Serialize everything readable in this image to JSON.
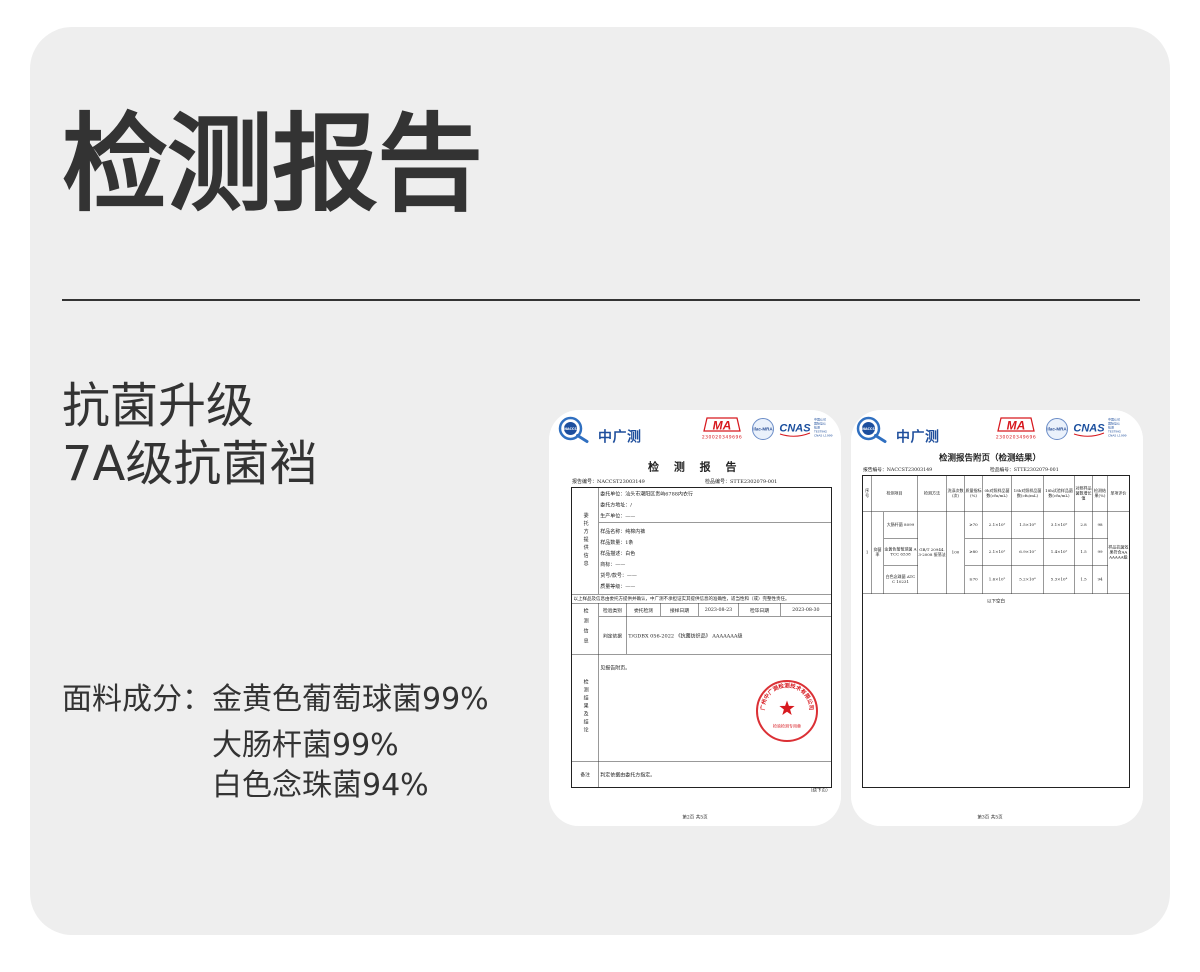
{
  "colors": {
    "page_bg": "#ffffff",
    "card_bg": "#eeeeee",
    "text": "#333333",
    "brand_blue": "#1e4e9c",
    "mark_red": "#d7191f"
  },
  "heading": {
    "title": "检测报告"
  },
  "headline": {
    "line1": "抗菌升级",
    "line2": "7A级抗菌裆"
  },
  "composition": {
    "label": "面料成分：",
    "items": [
      "金黄色葡萄球菌99%",
      "大肠杆菌99%",
      "白色念珠菌94%"
    ]
  },
  "report_main": {
    "header": {
      "logo_text": "NACCS",
      "brand": "中广测",
      "ma": "MA",
      "ma_number": "230020349696",
      "ilac": "ilac-MRA",
      "cnas": "CNAS",
      "cnas_caption": [
        "中国认可",
        "国际互认",
        "检测",
        "TESTING",
        "CNAS L1999"
      ]
    },
    "title": "检 测 报 告",
    "report_no": "报告编号：NACCST23003149",
    "sample_no": "检品编号：STTE2302079-001",
    "client": {
      "label": "委托方提供信息",
      "group1": [
        "委托单位：汕头市潮阳区贵屿6788内衣行",
        "委托方地址：/",
        "生产单位：——"
      ],
      "group2": [
        "样品名称：纯棉内裤",
        "样品数量：1条",
        "样品描述：白色",
        "商标：——",
        "货号/款号：——",
        "质量等级：——"
      ]
    },
    "note": "以上样品及信息由委托方提供并确认，中广测不承担证实其提供信息的准确性，适当性和（或）完整性责任。",
    "test_info": {
      "label": "检测信息",
      "fields": [
        "检验类别",
        "委托检测",
        "接样日期",
        "2023-08-23",
        "检毕日期",
        "2023-08-30"
      ],
      "basis_label": "判定依据",
      "basis": "T/GDBX 056-2022 《抗菌纺织品》 AAAAAAA级"
    },
    "result": {
      "label": "检测结果及结论",
      "text": "见报告附页。"
    },
    "seal": {
      "arc_text": "广州中广测检测技术有限公司",
      "bottom_text": "检验检测专用章"
    },
    "remark": {
      "label": "备注",
      "text": "判定依据由委托方指定。"
    },
    "continued": "（续下页）",
    "page": "第2页 共5页"
  },
  "report_annex": {
    "header": {
      "logo_text": "NACCS",
      "brand": "中广测",
      "ma": "MA",
      "ma_number": "230020349696",
      "ilac": "ilac-MRA",
      "cnas": "CNAS",
      "cnas_caption": [
        "中国认可",
        "国际互认",
        "检测",
        "TESTING",
        "CNAS L1999"
      ]
    },
    "title": "检测报告附页（检测结果）",
    "report_no": "报告编号：NACCST23003149",
    "sample_no": "检品编号：STTE2302079-001",
    "columns": [
      "序号",
      "检测项目",
      "检测方法",
      "洗涤次数(次)",
      "质量指标(%)",
      "0h对照样品菌数(cfu/mL)",
      "18h对照样品菌数(cfu/mL)",
      "18h试验样品菌数(cfu/mL)",
      "对照样品菌数增长值",
      "检测结果(%)",
      "单项评价"
    ],
    "serial": "1",
    "item": "抑菌率",
    "method": "GB/T 20944.3-2008 振荡法",
    "washes": "100",
    "evaluation": "样品抗菌效果符合AAAAAAA级",
    "rows": [
      {
        "organism": "大肠杆菌 8099",
        "standard": "≥70",
        "control_0h": "2.1×10⁵",
        "control_18h": "1.5×10⁸",
        "sample_18h": "3.1×10⁶",
        "growth": "2.8",
        "result": "98"
      },
      {
        "organism": "金黄色葡萄球菌 ATCC 6538",
        "standard": "≥80",
        "control_0h": "2.1×10⁵",
        "control_18h": "6.9×10⁷",
        "sample_18h": "1.4×10⁵",
        "growth": "1.5",
        "result": "99"
      },
      {
        "organism": "白色念珠菌 ATCC 10231",
        "standard": "≥70",
        "control_0h": "1.6×10⁵",
        "control_18h": "5.2×10⁶",
        "sample_18h": "5.3×10⁴",
        "growth": "1.5",
        "result": "94"
      }
    ],
    "blank_note": "以下空白",
    "page": "第3页 共5页"
  }
}
